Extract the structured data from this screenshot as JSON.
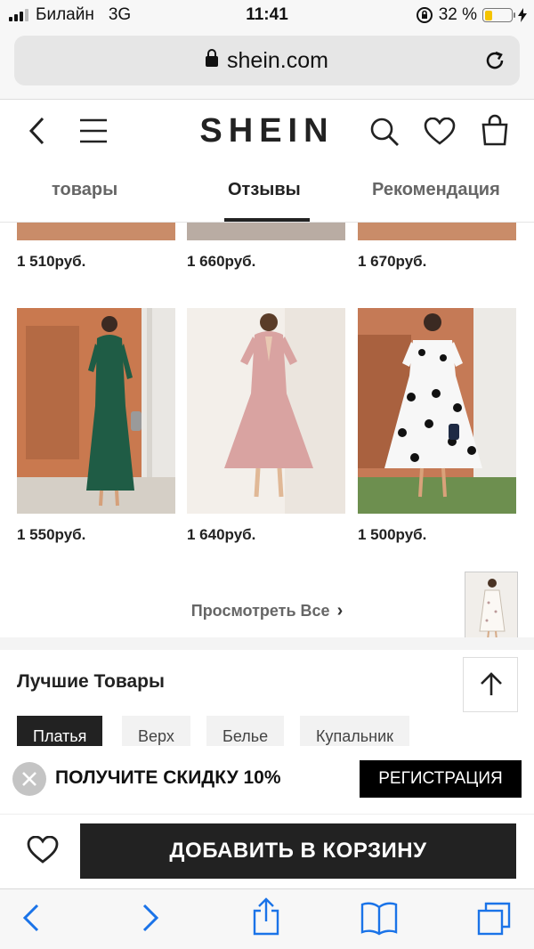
{
  "status_bar": {
    "carrier": "Билайн",
    "network": "3G",
    "time": "11:41",
    "battery": "32 %"
  },
  "browser": {
    "url": "shein.com"
  },
  "header": {
    "logo": "SHEIN"
  },
  "tabs": [
    {
      "label": "товары",
      "active": false
    },
    {
      "label": "Отзывы",
      "active": true
    },
    {
      "label": "Рекомендация",
      "active": false
    }
  ],
  "products_top": [
    {
      "price": "1 510руб."
    },
    {
      "price": "1 660руб."
    },
    {
      "price": "1 670руб."
    }
  ],
  "products": [
    {
      "price": "1 550руб.",
      "dress_color": "#1f5c45"
    },
    {
      "price": "1 640руб.",
      "dress_color": "#d9a3a1"
    },
    {
      "price": "1 500руб.",
      "dress_color": "#f7f7f7"
    }
  ],
  "view_all": "Просмотреть Все",
  "best": {
    "title": "Лучшие Товары",
    "chips": [
      {
        "label": "Платья",
        "active": true
      },
      {
        "label": "Верх",
        "active": false
      },
      {
        "label": "Белье",
        "active": false
      },
      {
        "label": "Купальник",
        "active": false
      }
    ]
  },
  "promo": {
    "text": "ПОЛУЧИТЕ СКИДКУ 10%",
    "button": "РЕГИСТРАЦИЯ"
  },
  "cart": {
    "add_label": "ДОБАВИТЬ В КОРЗИНУ"
  },
  "colors": {
    "accent": "#222222",
    "ios_blue": "#1a73e8",
    "battery_fill": "#f5c400"
  }
}
